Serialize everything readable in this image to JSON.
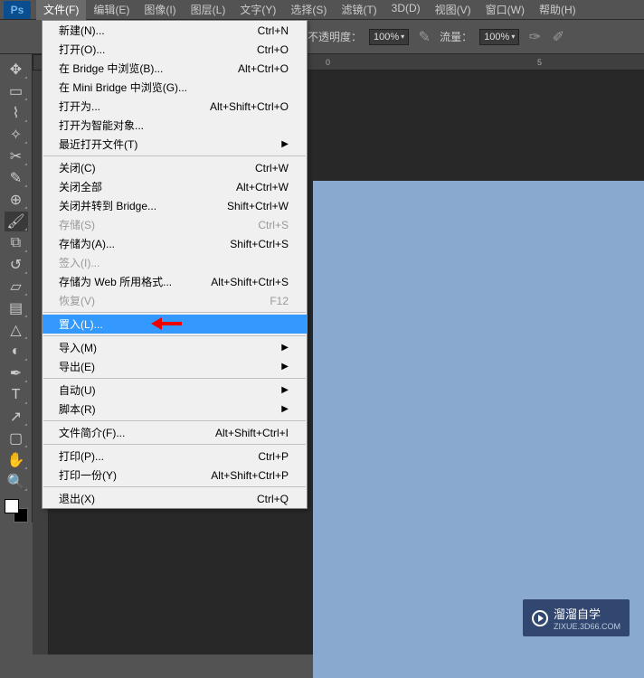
{
  "app": {
    "logo": "Ps"
  },
  "menubar": [
    {
      "label": "文件(F)",
      "active": true
    },
    {
      "label": "编辑(E)"
    },
    {
      "label": "图像(I)"
    },
    {
      "label": "图层(L)"
    },
    {
      "label": "文字(Y)"
    },
    {
      "label": "选择(S)"
    },
    {
      "label": "滤镜(T)"
    },
    {
      "label": "3D(D)"
    },
    {
      "label": "视图(V)"
    },
    {
      "label": "窗口(W)"
    },
    {
      "label": "帮助(H)"
    }
  ],
  "options": {
    "opacity_label": "不透明度：",
    "opacity_value": "100%",
    "flow_label": "流量：",
    "flow_value": "100%"
  },
  "ruler": {
    "mark0": "0",
    "mark5": "5"
  },
  "file_menu": [
    {
      "type": "item",
      "label": "新建(N)...",
      "shortcut": "Ctrl+N"
    },
    {
      "type": "item",
      "label": "打开(O)...",
      "shortcut": "Ctrl+O"
    },
    {
      "type": "item",
      "label": "在 Bridge 中浏览(B)...",
      "shortcut": "Alt+Ctrl+O"
    },
    {
      "type": "item",
      "label": "在 Mini Bridge 中浏览(G)..."
    },
    {
      "type": "item",
      "label": "打开为...",
      "shortcut": "Alt+Shift+Ctrl+O"
    },
    {
      "type": "item",
      "label": "打开为智能对象..."
    },
    {
      "type": "item",
      "label": "最近打开文件(T)",
      "submenu": true
    },
    {
      "type": "sep"
    },
    {
      "type": "item",
      "label": "关闭(C)",
      "shortcut": "Ctrl+W"
    },
    {
      "type": "item",
      "label": "关闭全部",
      "shortcut": "Alt+Ctrl+W"
    },
    {
      "type": "item",
      "label": "关闭并转到 Bridge...",
      "shortcut": "Shift+Ctrl+W"
    },
    {
      "type": "item",
      "label": "存储(S)",
      "shortcut": "Ctrl+S",
      "disabled": true
    },
    {
      "type": "item",
      "label": "存储为(A)...",
      "shortcut": "Shift+Ctrl+S"
    },
    {
      "type": "item",
      "label": "签入(I)...",
      "disabled": true
    },
    {
      "type": "item",
      "label": "存储为 Web 所用格式...",
      "shortcut": "Alt+Shift+Ctrl+S"
    },
    {
      "type": "item",
      "label": "恢复(V)",
      "shortcut": "F12",
      "disabled": true
    },
    {
      "type": "sep"
    },
    {
      "type": "item",
      "label": "置入(L)...",
      "highlighted": true,
      "arrow": true
    },
    {
      "type": "sep"
    },
    {
      "type": "item",
      "label": "导入(M)",
      "submenu": true
    },
    {
      "type": "item",
      "label": "导出(E)",
      "submenu": true
    },
    {
      "type": "sep"
    },
    {
      "type": "item",
      "label": "自动(U)",
      "submenu": true
    },
    {
      "type": "item",
      "label": "脚本(R)",
      "submenu": true
    },
    {
      "type": "sep"
    },
    {
      "type": "item",
      "label": "文件简介(F)...",
      "shortcut": "Alt+Shift+Ctrl+I"
    },
    {
      "type": "sep"
    },
    {
      "type": "item",
      "label": "打印(P)...",
      "shortcut": "Ctrl+P"
    },
    {
      "type": "item",
      "label": "打印一份(Y)",
      "shortcut": "Alt+Shift+Ctrl+P"
    },
    {
      "type": "sep"
    },
    {
      "type": "item",
      "label": "退出(X)",
      "shortcut": "Ctrl+Q"
    }
  ],
  "watermark": {
    "title": "溜溜自学",
    "url": "ZIXUE.3D66.COM"
  },
  "tools": [
    "move",
    "marquee",
    "lasso",
    "wand",
    "crop",
    "eyedropper",
    "spotheal",
    "brush",
    "stamp",
    "history",
    "eraser",
    "gradient",
    "blur",
    "dodge",
    "pen",
    "type",
    "path",
    "rect",
    "hand",
    "zoom"
  ]
}
